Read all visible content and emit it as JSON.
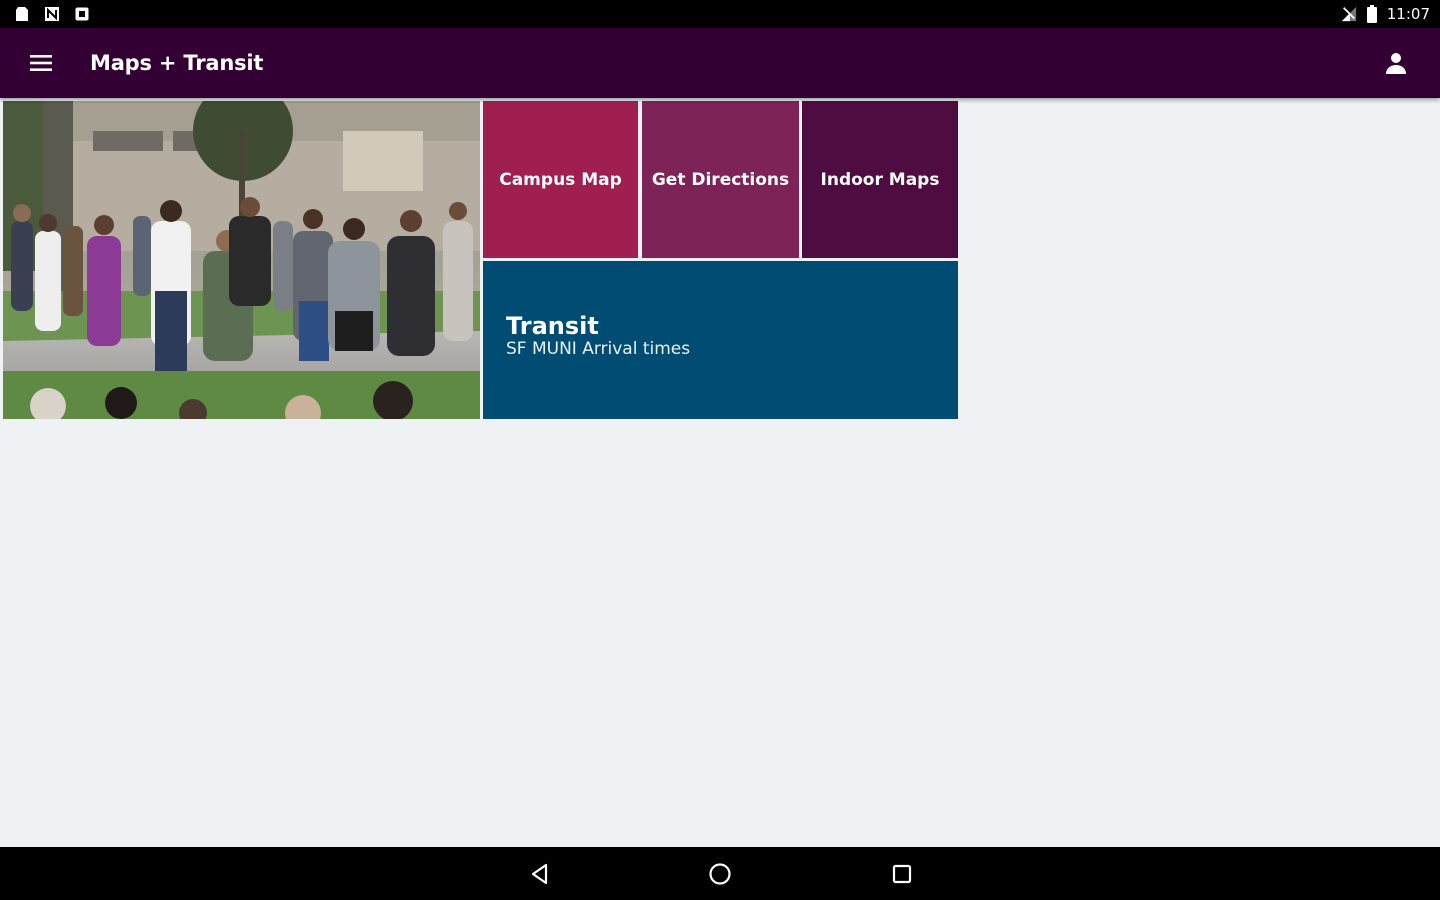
{
  "status_bar": {
    "time": "11:07",
    "icons": [
      "sd-card-icon",
      "n-icon",
      "screenshot-icon",
      "signal-icon",
      "battery-icon"
    ]
  },
  "app_bar": {
    "title": "Maps + Transit",
    "menu_icon": "hamburger-menu-icon",
    "account_icon": "person-icon",
    "background": "#320033"
  },
  "hero": {
    "description_icon": "campus-photo"
  },
  "tiles": {
    "campus_map": {
      "label": "Campus Map",
      "color": "#9e1f50"
    },
    "get_directions": {
      "label": "Get Directions",
      "color": "#7e2357"
    },
    "indoor_maps": {
      "label": "Indoor Maps",
      "color": "#4f0c40"
    },
    "transit": {
      "title": "Transit",
      "subtitle": "SF MUNI Arrival times",
      "color": "#004c73"
    }
  },
  "nav_bar": {
    "icons": [
      "back-icon",
      "home-icon",
      "recents-icon"
    ]
  }
}
